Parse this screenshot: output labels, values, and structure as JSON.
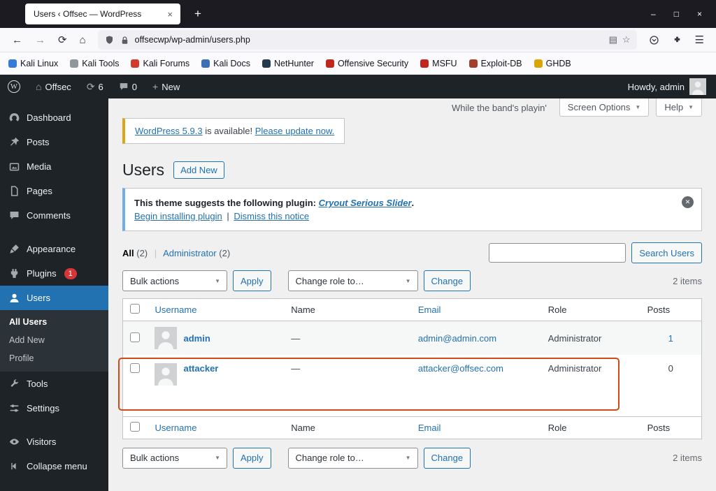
{
  "colors": {
    "accent": "#2271b1",
    "admin_bar_bg": "#1d2327",
    "sidebar_active": "#2271b1",
    "badge": "#d63638",
    "annotation": "#d04a17",
    "notice_blue": "#72aee6",
    "update_yellow": "#dba617"
  },
  "icons": {
    "plus": "+",
    "tab_close": "×",
    "minimize": "–",
    "maximize": "□",
    "close": "×",
    "back": "←",
    "forward": "→",
    "reload": "⟳",
    "home": "⌂",
    "reader": "▤",
    "star": "☆",
    "menu": "☰",
    "caret": "▼",
    "dismiss": "✕",
    "wp_logo": "W",
    "admin_home": "⌂",
    "updates": "⟳"
  },
  "browser": {
    "tab_title": "Users ‹ Offsec — WordPress",
    "url": "offsecwp/wp-admin/users.php",
    "bookmarks": [
      {
        "label": "Kali Linux",
        "color": "#367bd6"
      },
      {
        "label": "Kali Tools",
        "color": "#8e959d"
      },
      {
        "label": "Kali Forums",
        "color": "#d23c2e"
      },
      {
        "label": "Kali Docs",
        "color": "#3b6fb6"
      },
      {
        "label": "NetHunter",
        "color": "#24394f"
      },
      {
        "label": "Offensive Security",
        "color": "#c2271d"
      },
      {
        "label": "MSFU",
        "color": "#c2271d"
      },
      {
        "label": "Exploit-DB",
        "color": "#a33f2a"
      },
      {
        "label": "GHDB",
        "color": "#d9a404"
      }
    ]
  },
  "admin_bar": {
    "site_name": "Offsec",
    "updates_count": "6",
    "comments_count": "0",
    "new_label": "New",
    "howdy": "Howdy, admin"
  },
  "sidebar": {
    "items": [
      {
        "label": "Dashboard"
      },
      {
        "label": "Posts"
      },
      {
        "label": "Media"
      },
      {
        "label": "Pages"
      },
      {
        "label": "Comments"
      },
      {
        "label": "Appearance"
      },
      {
        "label": "Plugins"
      },
      {
        "label": "Users"
      },
      {
        "label": "Tools"
      },
      {
        "label": "Settings"
      },
      {
        "label": "Visitors"
      },
      {
        "label": "Collapse menu"
      }
    ],
    "plugins_badge": "1",
    "submenu": [
      "All Users",
      "Add New",
      "Profile"
    ]
  },
  "main": {
    "quote": "While the band's playin'",
    "screen_options_label": "Screen Options",
    "help_label": "Help",
    "update_notice": {
      "version_link": "WordPress 5.9.3",
      "text": " is available! ",
      "update_link": "Please update now."
    },
    "page_title": "Users",
    "add_new_label": "Add New",
    "theme_notice": {
      "bold_text": "This theme suggests the following plugin:",
      "plugin_link": "Cryout Serious Slider",
      "period": ".",
      "install_link": "Begin installing plugin",
      "separator": "|",
      "dismiss_link": "Dismiss this notice"
    },
    "filters": {
      "all_label": "All",
      "all_count": "(2)",
      "separator": "|",
      "admin_label": "Administrator",
      "admin_count": "(2)"
    },
    "search_button": "Search Users",
    "toolbar": {
      "bulk_actions": "Bulk actions",
      "apply": "Apply",
      "change_role": "Change role to…",
      "change": "Change",
      "items_count": "2 items"
    },
    "table": {
      "headers": {
        "username": "Username",
        "name": "Name",
        "email": "Email",
        "role": "Role",
        "posts": "Posts"
      },
      "rows": [
        {
          "username": "admin",
          "name": "—",
          "email": "admin@admin.com",
          "role": "Administrator",
          "posts": "1"
        },
        {
          "username": "attacker",
          "name": "—",
          "email": "attacker@offsec.com",
          "role": "Administrator",
          "posts": "0"
        }
      ]
    }
  }
}
